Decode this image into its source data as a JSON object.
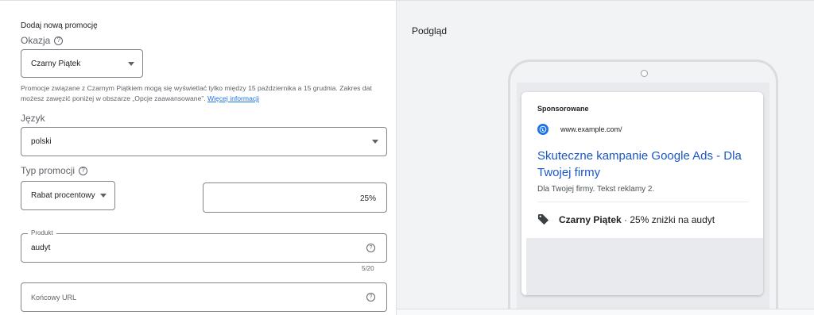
{
  "form": {
    "section_title": "Dodaj nową promocję",
    "occasion": {
      "label": "Okazja",
      "value": "Czarny Piątek"
    },
    "hint": {
      "text": "Promocje związane z Czarnym Piątkiem mogą się wyświetlać tylko między 15 października a 15 grudnia. Zakres dat możesz zawęzić poniżej w obszarze „Opcje zaawansowane”.",
      "link": "Więcej informacji"
    },
    "language": {
      "label": "Język",
      "value": "polski"
    },
    "promo_type": {
      "label": "Typ promocji",
      "value": "Rabat procentowy",
      "percent_value": "25%"
    },
    "product": {
      "label": "Produkt",
      "value": "audyt",
      "counter": "5/20"
    },
    "final_url": {
      "placeholder": "Końcowy URL"
    }
  },
  "preview": {
    "title": "Podgląd",
    "sponsored": "Sponsorowane",
    "url": "www.example.com/",
    "headline": "Skuteczne kampanie Google Ads - Dla Twojej firmy",
    "description": "Dla Twojej firmy. Tekst reklamy 2.",
    "promo_bold": "Czarny Piątek",
    "promo_rest": " · 25% zniżki na audyt"
  },
  "icons": [
    "help-icon",
    "chevron-down-icon",
    "globe-icon",
    "tag-icon"
  ],
  "colors": {
    "link": "#1a73e8",
    "headline": "#1a56c6",
    "panel_bg": "#f1f3f4"
  }
}
